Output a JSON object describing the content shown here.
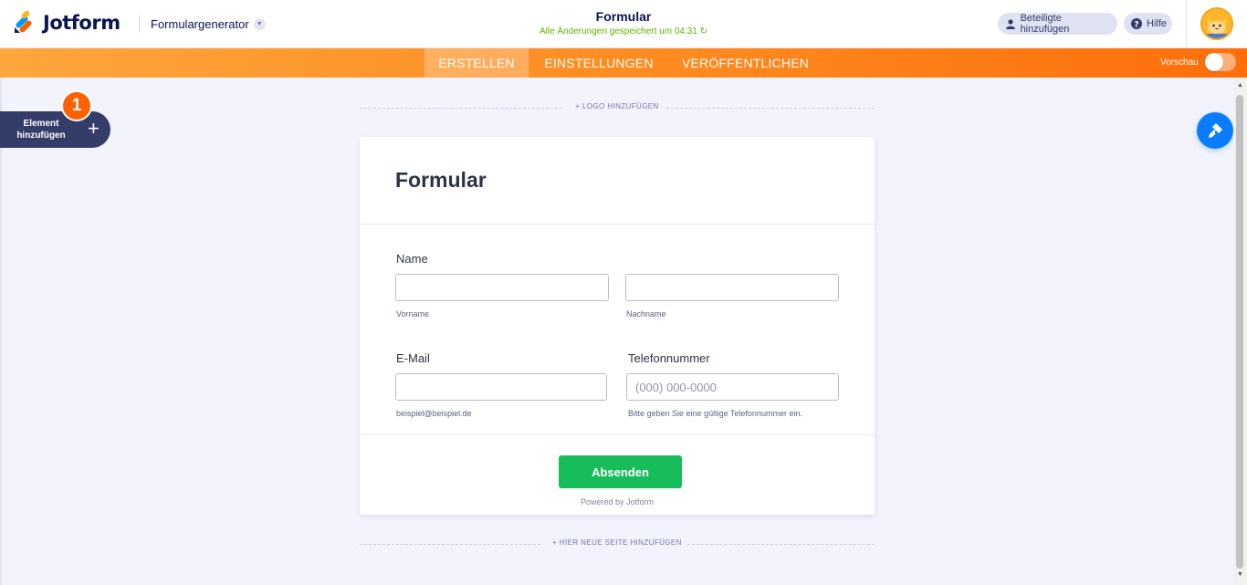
{
  "header": {
    "brand": "Jotform",
    "generator_label": "Formulargenerator",
    "form_title": "Formular",
    "saved_status": "Alle Änderungen gespeichert um 04:31",
    "add_participants": "Beteiligte hinzufügen",
    "help": "Hilfe"
  },
  "nav": {
    "tabs": [
      {
        "label": "ERSTELLEN",
        "active": true
      },
      {
        "label": "EINSTELLUNGEN",
        "active": false
      },
      {
        "label": "VERÖFFENTLICHEN",
        "active": false
      }
    ],
    "preview_label": "Vorschau",
    "preview_on": false
  },
  "sidebar": {
    "add_element_label": "Element hinzufügen",
    "badge_count": "1"
  },
  "canvas": {
    "add_logo": "+ LOGO HINZUFÜGEN",
    "add_page": "+ HIER NEUE SEITE HINZUFÜGEN"
  },
  "form": {
    "title": "Formular",
    "name_label": "Name",
    "first_name_sublabel": "Vorname",
    "last_name_sublabel": "Nachname",
    "email_label": "E-Mail",
    "email_sublabel": "beispiel@beispiel.de",
    "phone_label": "Telefonnummer",
    "phone_placeholder": "(000) 000-0000",
    "phone_sublabel": "Bitte geben Sie eine gültige Telefonnummer ein.",
    "submit_label": "Absenden",
    "powered_by": "Powered by Jotform"
  },
  "colors": {
    "brand_dark": "#0a1551",
    "accent_orange": "#ff6100",
    "submit_green": "#18bd5b",
    "designer_blue": "#0a7cff",
    "saved_green": "#64b200"
  }
}
